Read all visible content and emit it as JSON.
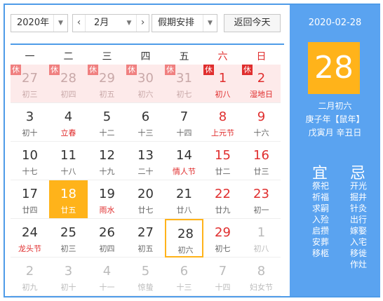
{
  "toolbar": {
    "year": "2020年",
    "month": "2月",
    "holiday": "假期安排",
    "today_btn": "返回今天",
    "prev": "‹",
    "next": "›",
    "dropdown_arrow": "▼"
  },
  "weekdays": [
    "一",
    "二",
    "三",
    "四",
    "五",
    "六",
    "日"
  ],
  "grid": [
    [
      {
        "d": "27",
        "l": "初三",
        "other": true,
        "rest": "休"
      },
      {
        "d": "28",
        "l": "初四",
        "other": true,
        "rest": "休"
      },
      {
        "d": "29",
        "l": "初五",
        "other": true,
        "rest": "休"
      },
      {
        "d": "30",
        "l": "初六",
        "other": true,
        "rest": "休"
      },
      {
        "d": "31",
        "l": "初七",
        "other": true,
        "rest": "休"
      },
      {
        "d": "1",
        "l": "初八",
        "rest": "休"
      },
      {
        "d": "2",
        "l": "湿地日",
        "rest": "休",
        "fest": true
      }
    ],
    [
      {
        "d": "3",
        "l": "初十"
      },
      {
        "d": "4",
        "l": "立春",
        "fest": true
      },
      {
        "d": "5",
        "l": "十二"
      },
      {
        "d": "6",
        "l": "十三"
      },
      {
        "d": "7",
        "l": "十四"
      },
      {
        "d": "8",
        "l": "上元节",
        "fest": true
      },
      {
        "d": "9",
        "l": "十六"
      }
    ],
    [
      {
        "d": "10",
        "l": "十七"
      },
      {
        "d": "11",
        "l": "十八"
      },
      {
        "d": "12",
        "l": "十九"
      },
      {
        "d": "13",
        "l": "二十"
      },
      {
        "d": "14",
        "l": "情人节",
        "fest": true
      },
      {
        "d": "15",
        "l": "廿二"
      },
      {
        "d": "16",
        "l": "廿三"
      }
    ],
    [
      {
        "d": "17",
        "l": "廿四"
      },
      {
        "d": "18",
        "l": "廿五",
        "selected": true
      },
      {
        "d": "19",
        "l": "雨水",
        "fest": true
      },
      {
        "d": "20",
        "l": "廿七"
      },
      {
        "d": "21",
        "l": "廿八"
      },
      {
        "d": "22",
        "l": "廿九"
      },
      {
        "d": "23",
        "l": "初一"
      }
    ],
    [
      {
        "d": "24",
        "l": "龙头节",
        "fest": true
      },
      {
        "d": "25",
        "l": "初三"
      },
      {
        "d": "26",
        "l": "初四"
      },
      {
        "d": "27",
        "l": "初五"
      },
      {
        "d": "28",
        "l": "初六",
        "today": true
      },
      {
        "d": "29",
        "l": "初七"
      },
      {
        "d": "1",
        "l": "初八",
        "other": true
      }
    ],
    [
      {
        "d": "2",
        "l": "初九",
        "other": true
      },
      {
        "d": "3",
        "l": "初十",
        "other": true
      },
      {
        "d": "4",
        "l": "十一",
        "other": true
      },
      {
        "d": "5",
        "l": "惊蛰",
        "other": true
      },
      {
        "d": "6",
        "l": "十三",
        "other": true
      },
      {
        "d": "7",
        "l": "十四",
        "other": true
      },
      {
        "d": "8",
        "l": "妇女节",
        "other": true
      }
    ]
  ],
  "side": {
    "date": "2020-02-28",
    "big": "28",
    "lunar": "二月初六",
    "ganzhi_year": "庚子年【鼠年】",
    "ganzhi_md": "戊寅月 辛丑日",
    "yi": "宜",
    "ji": "忌",
    "yi_items": [
      "祭祀",
      "祈福",
      "求嗣",
      "入殓",
      "启攒",
      "安葬",
      "移柩"
    ],
    "ji_items": [
      "开光",
      "掘井",
      "针灸",
      "出行",
      "嫁娶",
      "入宅",
      "移徙",
      "作灶"
    ]
  },
  "colors": {
    "accent": "#4e9be8",
    "side_bg": "#5aa3f0",
    "highlight": "#ffb31a",
    "red": "#e02e2e",
    "holiday_bg": "#fdeaea"
  }
}
